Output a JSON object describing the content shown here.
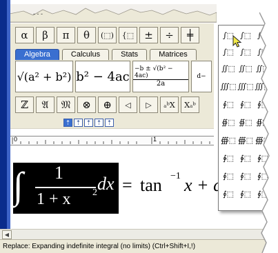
{
  "toolbar": {
    "symbols_row1": [
      "α",
      "β",
      "π",
      "θ",
      "(⬚)",
      "{⬚",
      "±",
      "÷",
      "╪",
      "∫⬚"
    ],
    "symbols_row2": [
      "ℤ",
      "𝔄",
      "𝔐",
      "⊗",
      "⊕",
      "◁",
      "▷",
      "ₐᵇX",
      "Xₐᵇ"
    ],
    "tabs": [
      {
        "label": "Algebra",
        "active": true
      },
      {
        "label": "Calculus",
        "active": false
      },
      {
        "label": "Stats",
        "active": false
      },
      {
        "label": "Matrices",
        "active": false
      }
    ],
    "templates": {
      "sqrt_sum": "√(a² + b²)",
      "discriminant": "b² − 4ac",
      "quadratic_num": "−b ± √(b² − 4ac)",
      "quadratic_den": "2a",
      "partial": "d−"
    },
    "small_buttons": [
      "⇡",
      "⇡",
      "⇡",
      "⇡",
      "⇡"
    ]
  },
  "ruler": {
    "label_zero": "0",
    "label_one": "1"
  },
  "equation": {
    "integral_sign": "∫",
    "numerator": "1",
    "denominator": "1 + x",
    "exponent": "2",
    "dx": "dx",
    "equals": "=",
    "rhs_tan": "tan",
    "rhs_exp": "−1",
    "rhs_x": "x + c"
  },
  "palette": {
    "items": [
      "∫⬚",
      "∫⬚",
      "∫⬚",
      "∫⬚",
      "∫⬚",
      "∫⬚",
      "∬⬚",
      "∬⬚",
      "∬⬚",
      "∭⬚",
      "∭⬚",
      "∭⬚",
      "∮⬚",
      "∮⬚",
      "∮⬚",
      "∯⬚",
      "∯⬚",
      "∯⬚",
      "∰⬚",
      "∰⬚",
      "∰⬚",
      "∳⬚",
      "∳⬚",
      "∳⬚",
      "∮⬚",
      "∮⬚",
      "∮⬚",
      "∮⬚",
      "∮⬚",
      "∮⬚"
    ]
  },
  "status": {
    "text": "Replace: Expanding indefinite integral (no limits) (Ctrl+Shift+I,!)"
  },
  "colors": {
    "accent": "#3a6fd0",
    "leftbar": "#0a2c8c",
    "panel": "#ece9d8"
  }
}
